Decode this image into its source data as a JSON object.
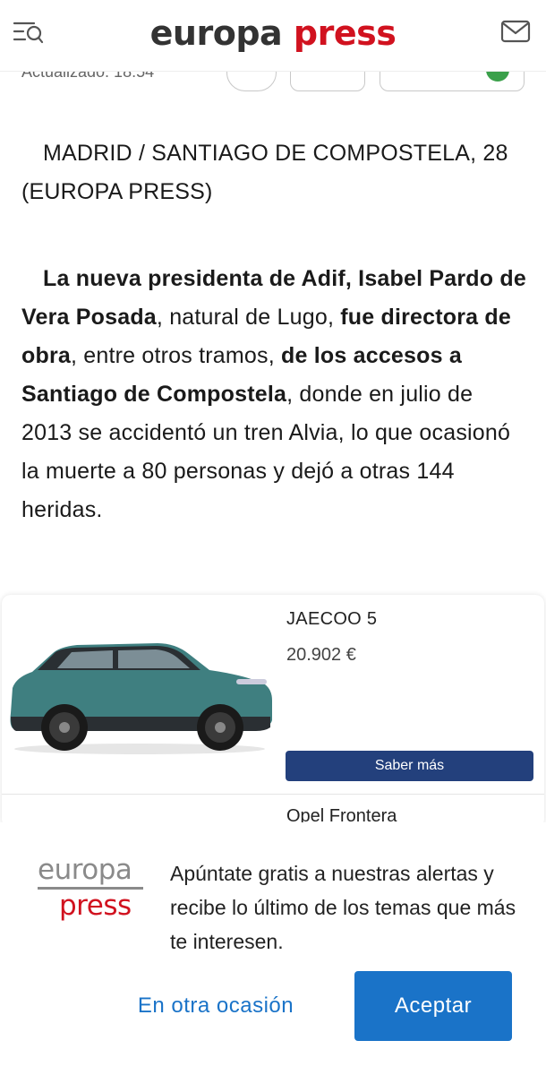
{
  "header": {
    "logo_word1": "europa",
    "logo_word2": "press",
    "menu_icon": "menu-search-icon",
    "mail_icon": "mail-icon",
    "brand_color": "#d1121f"
  },
  "meta": {
    "updated": "Actualizado: 18:54"
  },
  "article": {
    "dateline": "MADRID / SANTIAGO DE COMPOSTELA, 28 (EUROPA PRESS)",
    "lead": {
      "b1": "La nueva presidenta de Adif, Isabel Pardo de Vera Posada",
      "t1": ", natural de Lugo, ",
      "b2": "fue directora de obra",
      "t2": ", entre otros tramos, ",
      "b3": "de los accesos a Santiago de Compostela",
      "t3": ", donde en julio de 2013 se accidentó un tren Alvia, lo que ocasionó la muerte a 80 personas y dejó a otras 144 heridas."
    }
  },
  "ad": {
    "title": "JAECOO 5",
    "price": "20.902 €",
    "button": "Saber más",
    "next_title": "Opel Frontera",
    "button_color": "#23407c"
  },
  "subscribe": {
    "logo_word1": "europa",
    "logo_word2": "press",
    "text": "Apúntate gratis a nuestras alertas y recibe lo último de los temas que más te interesen.",
    "later": "En otra ocasión",
    "accept": "Aceptar",
    "accent_color": "#1a73c8"
  }
}
